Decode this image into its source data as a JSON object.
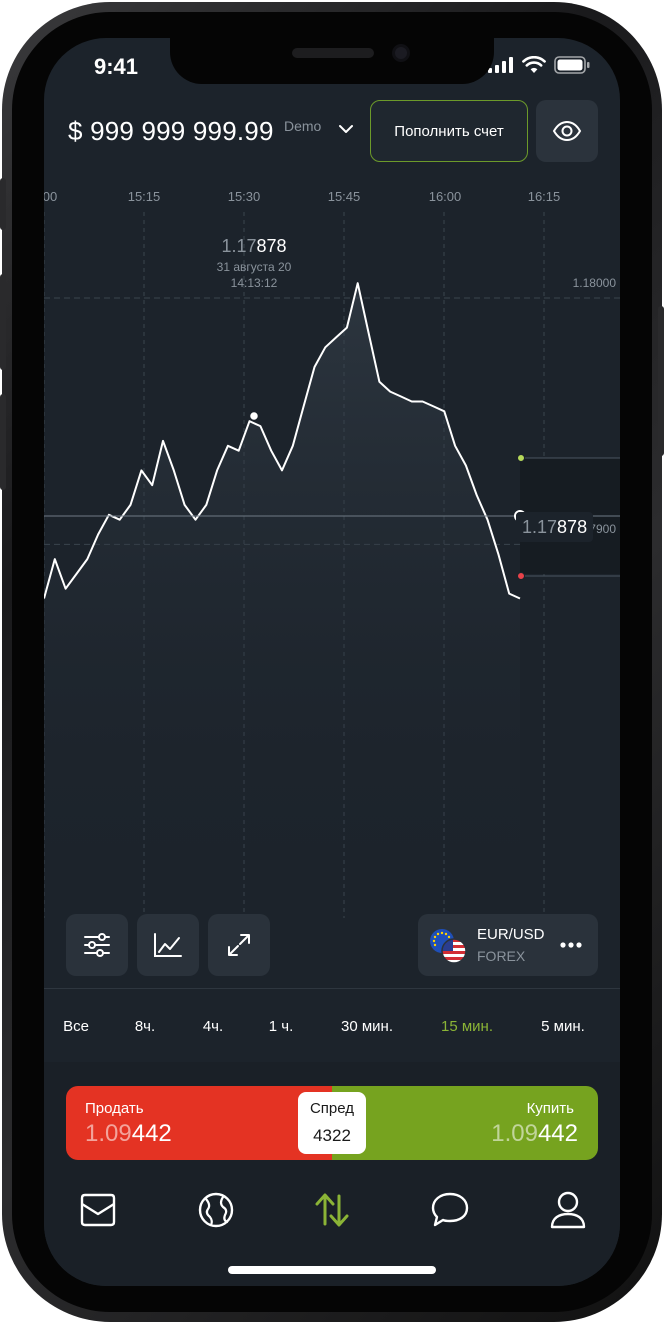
{
  "status_bar": {
    "time": "9:41"
  },
  "header": {
    "balance": "$ 999 999 999.99",
    "account_type": "Demo",
    "deposit_label": "Пополнить счет"
  },
  "chart": {
    "time_ticks": [
      "00",
      "15:15",
      "15:30",
      "15:45",
      "16:00",
      "16:15"
    ],
    "price_ticks": [
      "1.18000",
      "1.17900"
    ],
    "tooltip": {
      "price_dim": "1.17",
      "price_bold": "878",
      "date": "31 августа 20",
      "time": "14:13:12"
    },
    "current_price": {
      "dim": "1.17",
      "bold": "878"
    }
  },
  "chart_data": {
    "type": "area",
    "title": "",
    "xlabel": "",
    "ylabel": "",
    "x_ticks": [
      "00",
      "15:15",
      "15:30",
      "15:45",
      "16:00",
      "16:15"
    ],
    "y_ticks": [
      1.18,
      1.179
    ],
    "ylim": [
      1.17836,
      1.18
    ],
    "series": [
      {
        "values": [
          1.17878,
          1.17894,
          1.17882,
          1.17888,
          1.17894,
          1.17904,
          1.17912,
          1.1791,
          1.17916,
          1.1793,
          1.17924,
          1.17942,
          1.1793,
          1.17916,
          1.1791,
          1.17916,
          1.1793,
          1.1794,
          1.17938,
          1.1795,
          1.17948,
          1.17938,
          1.1793,
          1.1794,
          1.17956,
          1.17972,
          1.1798,
          1.17984,
          1.17988,
          1.18006,
          1.17986,
          1.17966,
          1.17962,
          1.1796,
          1.17958,
          1.17958,
          1.17956,
          1.17954,
          1.1794,
          1.17932,
          1.1792,
          1.1791,
          1.17896,
          1.1788,
          1.17878
        ]
      }
    ],
    "current": 1.17878,
    "selected_point": {
      "price": 1.17878,
      "date": "31 августа 20",
      "time": "14:13:12"
    }
  },
  "tools": {
    "pair_name": "EUR/USD",
    "pair_type": "FOREX"
  },
  "timeframes": [
    {
      "label": "Все"
    },
    {
      "label": "8ч."
    },
    {
      "label": "4ч."
    },
    {
      "label": "1 ч."
    },
    {
      "label": "30 мин."
    },
    {
      "label": "15 мин.",
      "active": true
    },
    {
      "label": "5 мин."
    }
  ],
  "trade": {
    "sell_label": "Продать",
    "sell_price_dim": "1.09",
    "sell_price_bold": "442",
    "buy_label": "Купить",
    "buy_price_dim": "1.09",
    "buy_price_bold": "442",
    "spread_label": "Спред",
    "spread_value": "4322"
  },
  "colors": {
    "accent_green": "#8bb436",
    "sell_red": "#e43323",
    "buy_green": "#76a31f",
    "background": "#1c232b"
  },
  "nav_icons": [
    "portfolio-icon",
    "globe-icon",
    "trade-arrows-icon",
    "chat-icon",
    "profile-icon"
  ]
}
